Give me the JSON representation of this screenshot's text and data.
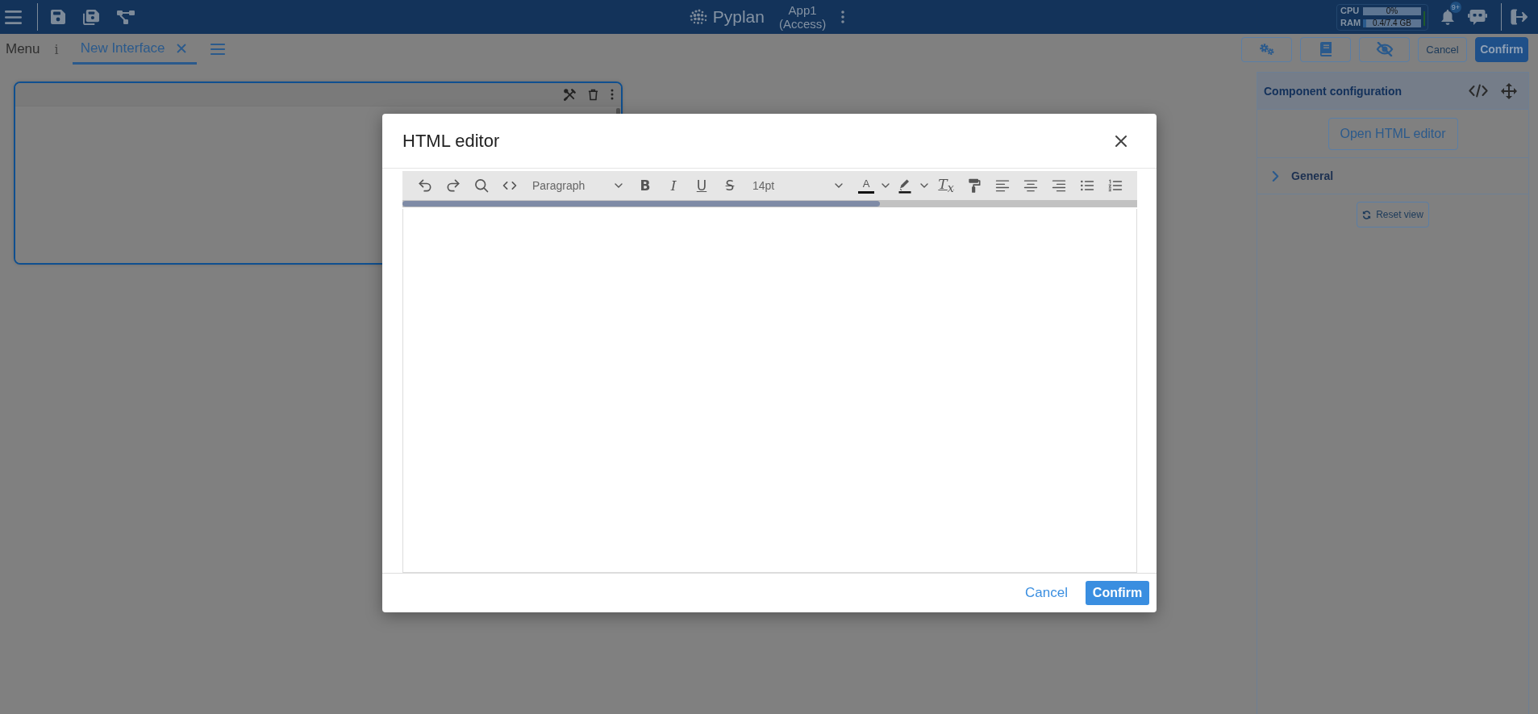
{
  "top_bar": {
    "brand": "Pyplan",
    "app_name": "App1",
    "app_mode": "(Access)",
    "resources": [
      {
        "label": "CPU",
        "reading": "0%"
      },
      {
        "label": "RAM",
        "reading": "0.4/7.4 GB",
        "level": 0.05
      }
    ],
    "notification_badge": "9+"
  },
  "tab_bar": {
    "menu_label": "Menu",
    "info_glyph": "i",
    "tabs": [
      {
        "label": "New Interface",
        "selected": true
      }
    ],
    "buttons": [
      {
        "label": "Cancel",
        "kind": "outline"
      },
      {
        "label": "Confirm",
        "kind": "primary"
      }
    ]
  },
  "canvas": {
    "components": [
      {
        "selected": true
      }
    ]
  },
  "config_panel": {
    "title": "Component configuration",
    "open_editor_button": "Open HTML editor",
    "sections": [
      {
        "label": "General",
        "expanded": false
      }
    ],
    "reset_button": "Reset view"
  },
  "modal": {
    "title": "HTML editor",
    "block_format": "Paragraph",
    "font_size": "14pt",
    "format_buttons": [
      {
        "kind": "bold",
        "glyph": "B"
      },
      {
        "kind": "italic",
        "glyph": "I"
      },
      {
        "kind": "underline",
        "glyph": "U"
      },
      {
        "kind": "strikethrough",
        "glyph": "S"
      }
    ],
    "text_color_glyph": "A",
    "clear_format_glyph": "T$_{x}$",
    "buttons": [
      {
        "label": "Cancel",
        "kind": "link"
      },
      {
        "label": "Confirm",
        "kind": "primary"
      }
    ]
  }
}
